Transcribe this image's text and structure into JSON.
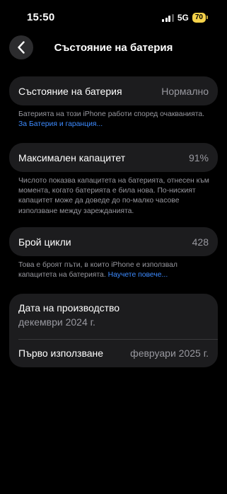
{
  "status_bar": {
    "time": "15:50",
    "network": "5G",
    "battery": "70"
  },
  "header": {
    "title": "Състояние на батерия"
  },
  "battery_state": {
    "label": "Състояние на батерия",
    "value": "Нормално",
    "footnote_text": "Батерията на този iPhone работи според очакванията.",
    "footnote_link": "За Батерия и гаранция..."
  },
  "max_capacity": {
    "label": "Максимален капацитет",
    "value": "91%",
    "footnote_text": "Числото показва капацитета на батерията, отнесен към момента, когато батерията е била нова. По-ниският капацитет може да доведе до по-малко часове използване между зарежданията."
  },
  "cycle_count": {
    "label": "Брой цикли",
    "value": "428",
    "footnote_text": "Това е броят пъти, в които iPhone е използвал капацитета на батерията.",
    "footnote_link": "Научете повече..."
  },
  "dates": {
    "manufacture_label": "Дата на производство",
    "manufacture_value": "декември 2024 г.",
    "first_use_label": "Първо използване",
    "first_use_value": "февруари 2025 г."
  }
}
